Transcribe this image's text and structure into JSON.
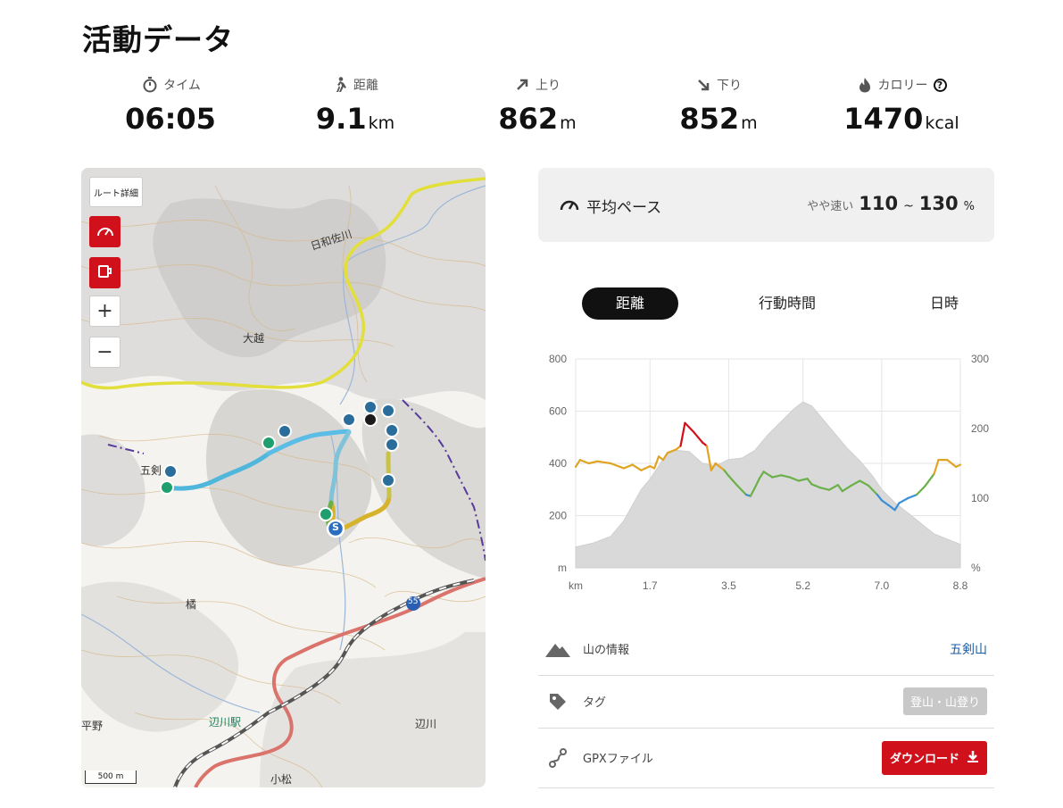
{
  "page": {
    "title": "活動データ"
  },
  "stats": [
    {
      "label": "タイム",
      "value": "06:05",
      "unit": "",
      "icon": "stopwatch-icon"
    },
    {
      "label": "距離",
      "value": "9.1",
      "unit": "km",
      "icon": "walker-icon"
    },
    {
      "label": "上り",
      "value": "862",
      "unit": "m",
      "icon": "arrow-up-right-icon"
    },
    {
      "label": "下り",
      "value": "852",
      "unit": "m",
      "icon": "arrow-down-right-icon"
    },
    {
      "label": "カロリー",
      "value": "1470",
      "unit": "kcal",
      "icon": "flame-icon",
      "help": "?"
    }
  ],
  "map": {
    "route_detail_label": "ルート詳細",
    "zoom_in": "+",
    "zoom_out": "−",
    "labels": {
      "river": "日和佐川",
      "okoshi": "大越",
      "gokenzan": "五剣",
      "tachibana": "橘",
      "station": "辺川駅",
      "hegawa": "辺川",
      "hirano": "平野",
      "komatsu": "小松",
      "route_no": "55",
      "start": "S"
    },
    "scale": "500 m"
  },
  "pace": {
    "label": "平均ペース",
    "description": "やや速い",
    "min": "110",
    "tilde": "~",
    "max": "130",
    "unit": "%"
  },
  "tabs": [
    {
      "label": "距離",
      "active": true
    },
    {
      "label": "行動時間",
      "active": false
    },
    {
      "label": "日時",
      "active": false
    }
  ],
  "chart_data": {
    "type": "area",
    "x_unit": "km",
    "xlim": [
      0,
      8.8
    ],
    "x_ticks": [
      "km",
      "1.7",
      "3.5",
      "5.2",
      "7.0",
      "8.8"
    ],
    "y_left_unit": "m",
    "y_left_lim": [
      0,
      800
    ],
    "y_left_ticks": [
      "800",
      "600",
      "400",
      "200",
      "m"
    ],
    "y_right_unit": "%",
    "y_right_lim": [
      0,
      300
    ],
    "y_right_ticks": [
      "300",
      "200",
      "100",
      "%"
    ],
    "grid": true,
    "series": [
      {
        "values": [
          [
            0.0,
            80
          ],
          [
            0.4,
            95
          ],
          [
            0.8,
            120
          ],
          [
            1.1,
            180
          ],
          [
            1.3,
            240
          ],
          [
            1.5,
            300
          ],
          [
            1.7,
            340
          ],
          [
            1.9,
            390
          ],
          [
            2.1,
            440
          ],
          [
            2.3,
            450
          ],
          [
            2.6,
            445
          ],
          [
            2.9,
            400
          ],
          [
            3.2,
            390
          ],
          [
            3.5,
            415
          ],
          [
            3.8,
            420
          ],
          [
            4.1,
            450
          ],
          [
            4.4,
            510
          ],
          [
            4.7,
            560
          ],
          [
            5.0,
            610
          ],
          [
            5.2,
            635
          ],
          [
            5.4,
            620
          ],
          [
            5.6,
            580
          ],
          [
            5.9,
            520
          ],
          [
            6.2,
            460
          ],
          [
            6.5,
            410
          ],
          [
            6.8,
            350
          ],
          [
            7.0,
            300
          ],
          [
            7.3,
            250
          ],
          [
            7.6,
            210
          ],
          [
            7.9,
            170
          ],
          [
            8.2,
            130
          ],
          [
            8.5,
            110
          ],
          [
            8.8,
            90
          ]
        ]
      },
      {
        "values": [
          [
            0.0,
            145
          ],
          [
            0.1,
            155
          ],
          [
            0.3,
            150
          ],
          [
            0.5,
            153
          ],
          [
            0.8,
            150
          ],
          [
            1.1,
            143
          ],
          [
            1.3,
            148
          ],
          [
            1.5,
            140
          ],
          [
            1.7,
            146
          ],
          [
            1.8,
            143
          ],
          [
            1.9,
            160
          ],
          [
            2.0,
            155
          ],
          [
            2.1,
            165
          ],
          [
            2.3,
            170
          ],
          [
            2.4,
            175
          ],
          [
            2.5,
            208
          ],
          [
            2.7,
            195
          ],
          [
            2.9,
            180
          ],
          [
            3.0,
            175
          ],
          [
            3.1,
            140
          ],
          [
            3.2,
            150
          ],
          [
            3.4,
            140
          ],
          [
            3.5,
            132
          ],
          [
            3.7,
            118
          ],
          [
            3.9,
            105
          ],
          [
            4.0,
            103
          ],
          [
            4.1,
            115
          ],
          [
            4.2,
            128
          ],
          [
            4.3,
            138
          ],
          [
            4.5,
            130
          ],
          [
            4.7,
            133
          ],
          [
            4.9,
            130
          ],
          [
            5.1,
            125
          ],
          [
            5.3,
            128
          ],
          [
            5.4,
            120
          ],
          [
            5.6,
            115
          ],
          [
            5.8,
            112
          ],
          [
            6.0,
            119
          ],
          [
            6.1,
            110
          ],
          [
            6.3,
            118
          ],
          [
            6.5,
            125
          ],
          [
            6.7,
            118
          ],
          [
            6.9,
            105
          ],
          [
            7.0,
            97
          ],
          [
            7.2,
            88
          ],
          [
            7.3,
            83
          ],
          [
            7.4,
            93
          ],
          [
            7.6,
            100
          ],
          [
            7.8,
            105
          ],
          [
            8.0,
            118
          ],
          [
            8.2,
            135
          ],
          [
            8.3,
            155
          ],
          [
            8.5,
            155
          ],
          [
            8.7,
            145
          ],
          [
            8.8,
            148
          ]
        ]
      }
    ],
    "colors": {
      "pace_slow": "#3a8fd6",
      "pace_mid": "#6bb04a",
      "pace_fast": "#e0a423",
      "pace_very_fast": "#d0111b",
      "elevation_fill": "#d9d9d9"
    }
  },
  "info": {
    "mountain": {
      "label": "山の情報",
      "value": "五剣山",
      "icon": "mountain-icon"
    },
    "tag": {
      "label": "タグ",
      "value": "登山・山登り",
      "icon": "tag-icon"
    },
    "gpx": {
      "label": "GPXファイル",
      "button": "ダウンロード",
      "icon": "route-file-icon"
    }
  }
}
